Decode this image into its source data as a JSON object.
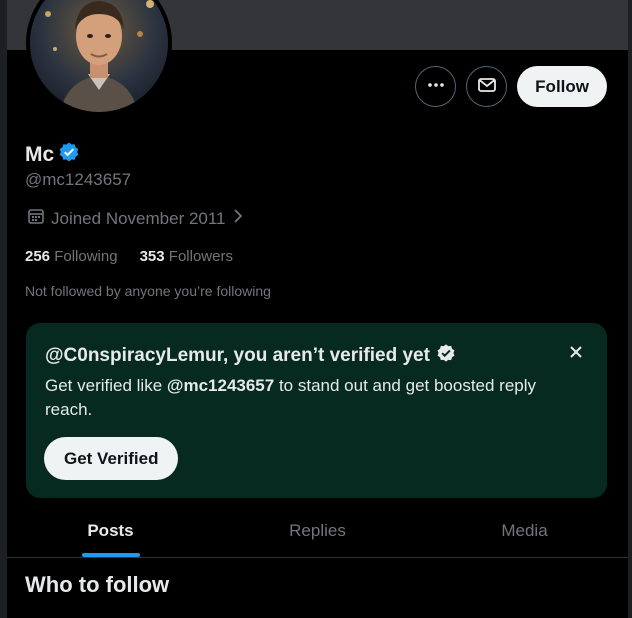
{
  "profile": {
    "name": "Mc",
    "handle": "@mc1243657",
    "joined": "Joined November 2011",
    "following_count": "256",
    "following_label": "Following",
    "followers_count": "353",
    "followers_label": "Followers",
    "not_followed": "Not followed by anyone you’re following",
    "verified_badge_color": "#1d9bf0"
  },
  "actions": {
    "more_icon": "more-horizontal-icon",
    "message_icon": "envelope-icon",
    "follow_label": "Follow"
  },
  "verify_card": {
    "title": "@C0nspiracyLemur, you aren’t verified yet",
    "body_prefix": "Get verified like ",
    "body_handle": "@mc1243657",
    "body_suffix": " to stand out and get boosted reply reach.",
    "button_label": "Get Verified",
    "background": "#062a1f"
  },
  "tabs": [
    {
      "label": "Posts",
      "active": true
    },
    {
      "label": "Replies",
      "active": false
    },
    {
      "label": "Media",
      "active": false
    }
  ],
  "section_heading": "Who to follow",
  "colors": {
    "accent": "#1d9bf0",
    "text_primary": "#e7e9ea",
    "text_secondary": "#71767b",
    "background": "#000000"
  }
}
